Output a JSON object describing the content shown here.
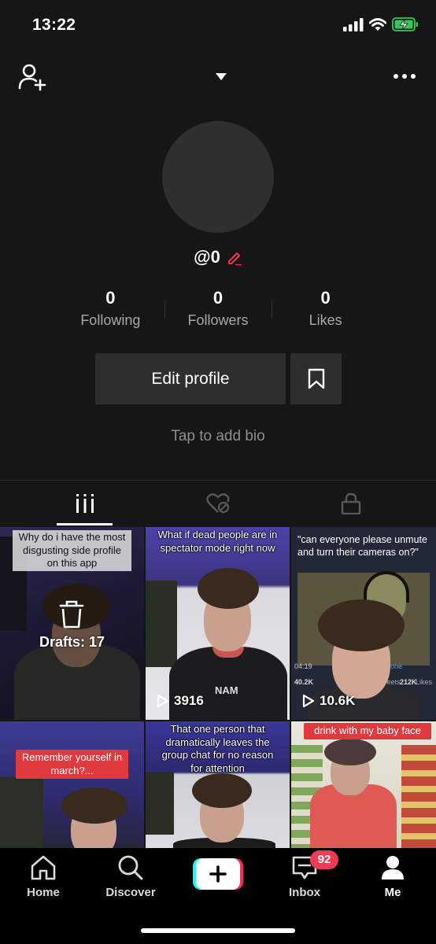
{
  "status_bar": {
    "time": "13:22"
  },
  "profile": {
    "username": "@0",
    "stats": [
      {
        "value": "0",
        "label": "Following"
      },
      {
        "value": "0",
        "label": "Followers"
      },
      {
        "value": "0",
        "label": "Likes"
      }
    ],
    "edit_profile_label": "Edit profile",
    "bio_placeholder": "Tap to add bio"
  },
  "tabs": [
    {
      "icon": "grid-icon",
      "active": true
    },
    {
      "icon": "liked-hidden-icon",
      "active": false
    },
    {
      "icon": "lock-icon",
      "active": false
    }
  ],
  "videos": [
    {
      "caption": "Why do i have the most disgusting side profile on this app",
      "overlay": "Drafts: 17"
    },
    {
      "caption": "What if dead people are in spectator mode right now",
      "views": "3916",
      "shirt_text": "NAM"
    },
    {
      "caption": "\"can everyone please unmute and turn their cameras on?\"",
      "views": "10.6K",
      "tweet_time": "04:19",
      "tweet_src": "iPhone",
      "tweet_retweets": "40.2K",
      "tweet_likes": "212K",
      "tweet_likes_lbl": "Likes",
      "tweet_rt_lbl": "Tweets"
    },
    {
      "caption": "Remember yourself in march?..."
    },
    {
      "caption": "That one person that dramatically leaves the group chat for no reason for attention"
    },
    {
      "caption": "drink with my baby face"
    }
  ],
  "nav": {
    "home": "Home",
    "discover": "Discover",
    "inbox": "Inbox",
    "inbox_badge": "92",
    "me": "Me"
  },
  "colors": {
    "accent": "#fe2c55",
    "badge": "#f03b54",
    "bg": "#161616"
  }
}
